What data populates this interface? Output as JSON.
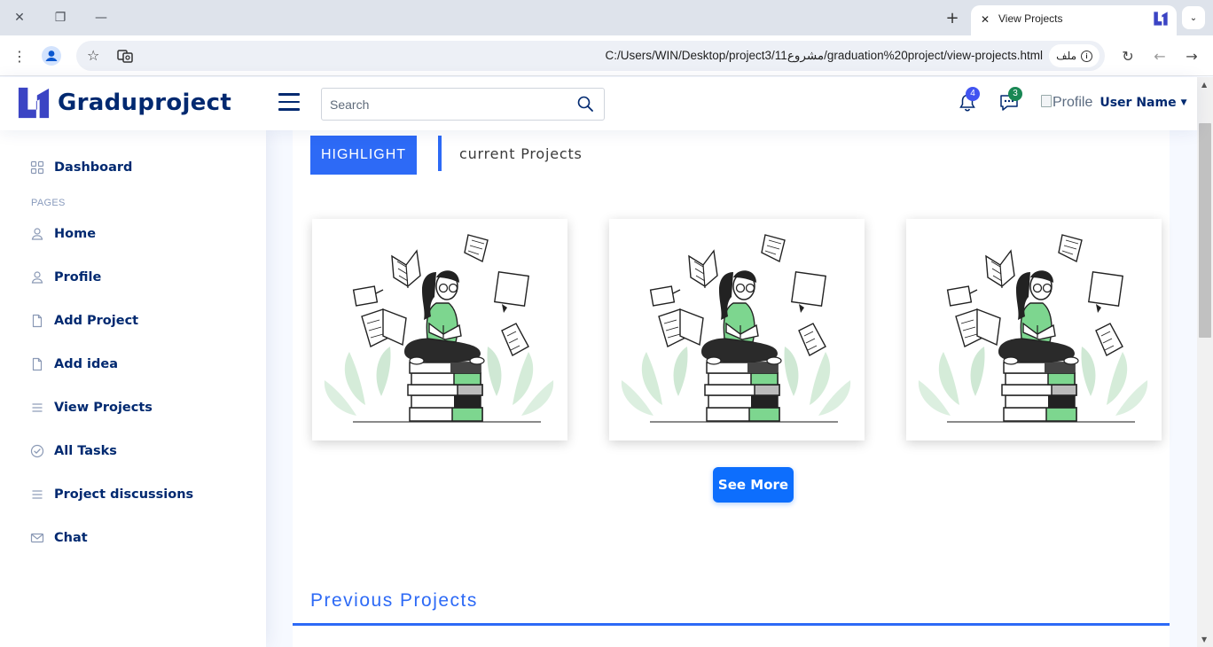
{
  "browser": {
    "tab_title": "View Projects",
    "url": "C:/Users/WIN/Desktop/project3/11مشروع/graduation%20project/view-projects.html",
    "file_chip": "ملف"
  },
  "header": {
    "brand": "Graduproject",
    "search_placeholder": "Search",
    "notifications_count": "4",
    "messages_count": "3",
    "profile_img_alt": "Profile",
    "user_name": "User Name"
  },
  "sidebar": {
    "pages_heading": "PAGES",
    "items": [
      {
        "label": "Dashboard",
        "icon": "grid-icon"
      },
      {
        "label": "Home",
        "icon": "person-icon"
      },
      {
        "label": "Profile",
        "icon": "person-icon"
      },
      {
        "label": "Add Project",
        "icon": "file-icon"
      },
      {
        "label": "Add idea",
        "icon": "file-icon"
      },
      {
        "label": "View Projects",
        "icon": "list-icon"
      },
      {
        "label": "All Tasks",
        "icon": "check-circle-icon"
      },
      {
        "label": "Project discussions",
        "icon": "list-icon"
      },
      {
        "label": "Chat",
        "icon": "envelope-icon"
      }
    ]
  },
  "main": {
    "highlight_label": "HIGHLIGHT",
    "current_title": "current Projects",
    "see_more_label": "See More",
    "previous_title": "Previous Projects"
  },
  "colors": {
    "accent": "#2d6af6",
    "navy": "#012970",
    "button": "#0d6efd",
    "illustration_green": "#7dd68f"
  }
}
